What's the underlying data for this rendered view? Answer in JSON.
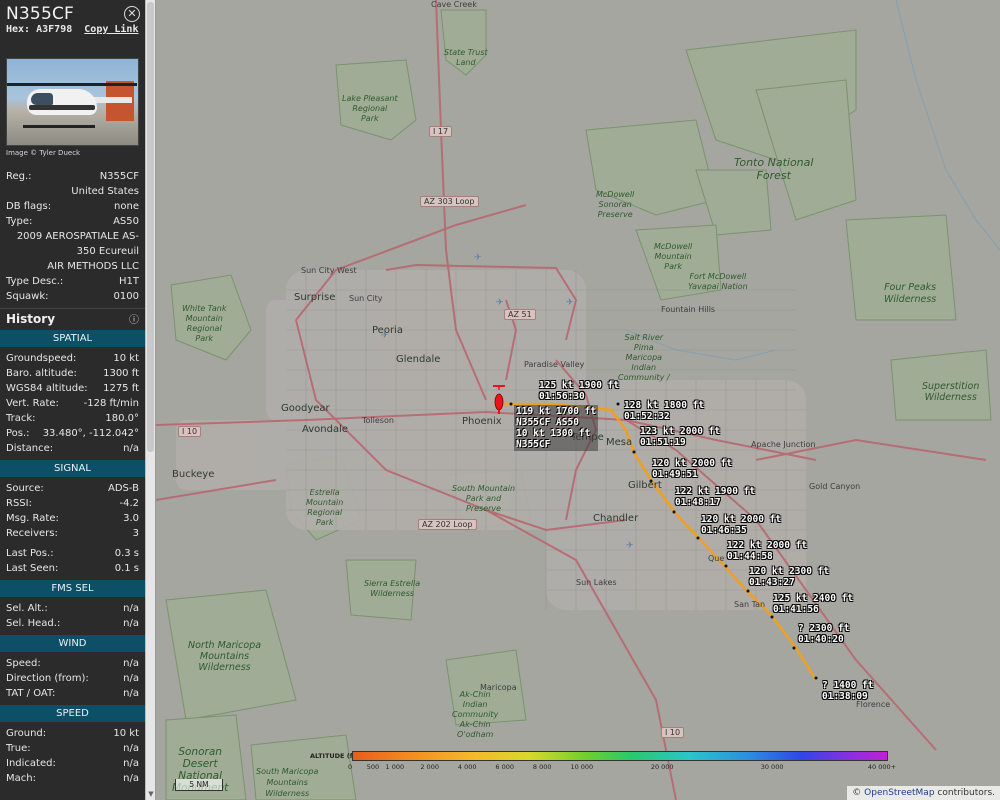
{
  "aircraft": {
    "callsign": "N355CF",
    "hex_label": "Hex:",
    "hex": "A3F798",
    "copy_link": "Copy Link",
    "photo_credit": "Image © Tyler Dueck",
    "close_icon": "close-circle-icon"
  },
  "details": {
    "reg_label": "Reg.:",
    "reg": "N355CF",
    "country": "United States",
    "dbflags_label": "DB flags:",
    "dbflags": "none",
    "type_label": "Type:",
    "type": "AS50",
    "type_full_1": "2009 AEROSPATIALE AS-",
    "type_full_2": "350 Ecureuil",
    "operator": "AIR METHODS LLC",
    "typedesc_label": "Type Desc.:",
    "typedesc": "H1T",
    "squawk_label": "Squawk:",
    "squawk": "0100"
  },
  "history": {
    "title": "History",
    "icon": "info-icon"
  },
  "spatial": {
    "title": "SPATIAL",
    "rows": [
      {
        "label": "Groundspeed:",
        "value": "10 kt"
      },
      {
        "label": "Baro. altitude:",
        "value": "1300 ft"
      },
      {
        "label": "WGS84 altitude:",
        "value": "1275 ft"
      },
      {
        "label": "Vert. Rate:",
        "value": "-128 ft/min"
      },
      {
        "label": "Track:",
        "value": "180.0°"
      },
      {
        "label": "Pos.:",
        "value": "33.480°, -112.042°"
      },
      {
        "label": "Distance:",
        "value": "n/a"
      }
    ]
  },
  "signal": {
    "title": "SIGNAL",
    "rows": [
      {
        "label": "Source:",
        "value": "ADS-B"
      },
      {
        "label": "RSSI:",
        "value": "-4.2"
      },
      {
        "label": "Msg. Rate:",
        "value": "3.0"
      },
      {
        "label": "Receivers:",
        "value": "3"
      }
    ],
    "rows2": [
      {
        "label": "Last Pos.:",
        "value": "0.3 s"
      },
      {
        "label": "Last Seen:",
        "value": "0.1 s"
      }
    ]
  },
  "fms": {
    "title": "FMS SEL",
    "rows": [
      {
        "label": "Sel. Alt.:",
        "value": "n/a"
      },
      {
        "label": "Sel. Head.:",
        "value": "n/a"
      }
    ]
  },
  "wind": {
    "title": "WIND",
    "rows": [
      {
        "label": "Speed:",
        "value": "n/a"
      },
      {
        "label": "Direction (from):",
        "value": "n/a"
      },
      {
        "label": "TAT / OAT:",
        "value": "n/a"
      }
    ]
  },
  "speed": {
    "title": "SPEED",
    "rows": [
      {
        "label": "Ground:",
        "value": "10 kt"
      },
      {
        "label": "True:",
        "value": "n/a"
      },
      {
        "label": "Indicated:",
        "value": "n/a"
      },
      {
        "label": "Mach:",
        "value": "n/a"
      }
    ]
  },
  "map": {
    "places": {
      "surprise": "Surprise",
      "sun_city_west": "Sun City West",
      "sun_city": "Sun City",
      "peoria": "Peoria",
      "glendale": "Glendale",
      "phoenix": "Phoenix",
      "goodyear": "Goodyear",
      "avondale": "Avondale",
      "tolleson": "Tolleson",
      "buckeye": "Buckeye",
      "mesa": "Mesa",
      "tempe": "Tempe",
      "gilbert": "Gilbert",
      "chandler": "Chandler",
      "sun_lakes": "Sun Lakes",
      "paradise_valley": "Paradise Valley",
      "fountain_hills": "Fountain Hills",
      "apache_junction": "Apache Junction",
      "gold_canyon": "Gold Canyon",
      "queen_creek": "Que",
      "san_tan": "San Tan",
      "florence": "Florence",
      "maricopa": "Maricopa",
      "cave": "Cave Creek"
    },
    "parks": {
      "state_trust_1": "State Trust",
      "state_trust_2": "Land",
      "lake_pleasant_1": "Lake Pleasant",
      "lake_pleasant_2": "Regional",
      "lake_pleasant_3": "Park",
      "tonto_1": "Tonto National",
      "tonto_2": "Forest",
      "mcdowell_sonoran_1": "McDowell",
      "mcdowell_sonoran_2": "Sonoran",
      "mcdowell_sonoran_3": "Preserve",
      "mcdowell_mountain_1": "McDowell",
      "mcdowell_mountain_2": "Mountain",
      "mcdowell_mountain_3": "Park",
      "fort_mcdowell_1": "Fort McDowell",
      "fort_mcdowell_2": "Yavapai Nation",
      "four_peaks_1": "Four Peaks",
      "four_peaks_2": "Wilderness",
      "white_tank_1": "White Tank",
      "white_tank_2": "Mountain",
      "white_tank_3": "Regional",
      "white_tank_4": "Park",
      "srpmic_1": "Salt River",
      "srpmic_2": "Pima",
      "srpmic_3": "Maricopa",
      "srpmic_4": "Indian",
      "srpmic_5": "Community /",
      "superstition_1": "Superstition",
      "superstition_2": "Wilderness",
      "south_mountain_1": "South Mountain",
      "south_mountain_2": "Park and",
      "south_mountain_3": "Preserve",
      "estrella_1": "Estrella",
      "estrella_2": "Mountain",
      "estrella_3": "Regional",
      "estrella_4": "Park",
      "sierra_estrella_1": "Sierra Estrella",
      "sierra_estrella_2": "Wilderness",
      "north_maricopa_1": "North Maricopa",
      "north_maricopa_2": "Mountains",
      "north_maricopa_3": "Wilderness",
      "akchin_1": "Ak-Chin",
      "akchin_2": "Indian",
      "akchin_3": "Community",
      "akchin_4": "Ak-Chin",
      "akchin_5": "O'odham",
      "sonoran_1": "Sonoran",
      "sonoran_2": "Desert",
      "sonoran_3": "National",
      "sonoran_4": "Monument",
      "south_maricopa_1": "South Maricopa",
      "south_maricopa_2": "Mountains",
      "south_maricopa_3": "Wilderness"
    },
    "shields": {
      "i17": "I 17",
      "az303": "AZ 303 Loop",
      "az51": "AZ 51",
      "i10_w": "I 10",
      "az202": "AZ 202 Loop",
      "i10_s": "I 10"
    },
    "track_labels": [
      {
        "l1": "125 kt  1900 ft",
        "l2": "01:56:30"
      },
      {
        "l1": "128 kt  1800 ft",
        "l2": "01:52:32"
      },
      {
        "l1": "123 kt  2000 ft",
        "l2": "01:51:19"
      },
      {
        "l1": "120 kt  2000 ft",
        "l2": "01:49:51"
      },
      {
        "l1": "122 kt  1900 ft",
        "l2": "01:48:17"
      },
      {
        "l1": "120 kt  2000 ft",
        "l2": "01:46:35"
      },
      {
        "l1": "122 kt  2000 ft",
        "l2": "01:44:58"
      },
      {
        "l1": "120 kt  2300 ft",
        "l2": "01:43:27"
      },
      {
        "l1": "125 kt  2400 ft",
        "l2": "01:41:56"
      },
      {
        "l1": "?    2300 ft",
        "l2": "01:40:20"
      },
      {
        "l1": "?    1400 ft",
        "l2": "01:38:09"
      }
    ],
    "aircraft_label": {
      "l1": "119 kt  1700 ft",
      "l2": "N355CF AS50",
      "l3": "10 kt  1300 ft",
      "l4": "N355CF"
    },
    "altitude_legend": {
      "label": "ALTITUDE (ft)",
      "ticks": [
        "0",
        "500",
        "1 000",
        "2 000",
        "4 000",
        "6 000",
        "8 000",
        "10 000",
        "20 000",
        "30 000",
        "40 000+"
      ]
    },
    "scale": "5 NM",
    "attribution_prefix": "© ",
    "attribution_link": "OpenStreetMap",
    "attribution_suffix": " contributors.",
    "colors": {
      "track": "#f0a020",
      "aircraft": "#e8141a",
      "section_bar": "#0c4f66"
    }
  }
}
